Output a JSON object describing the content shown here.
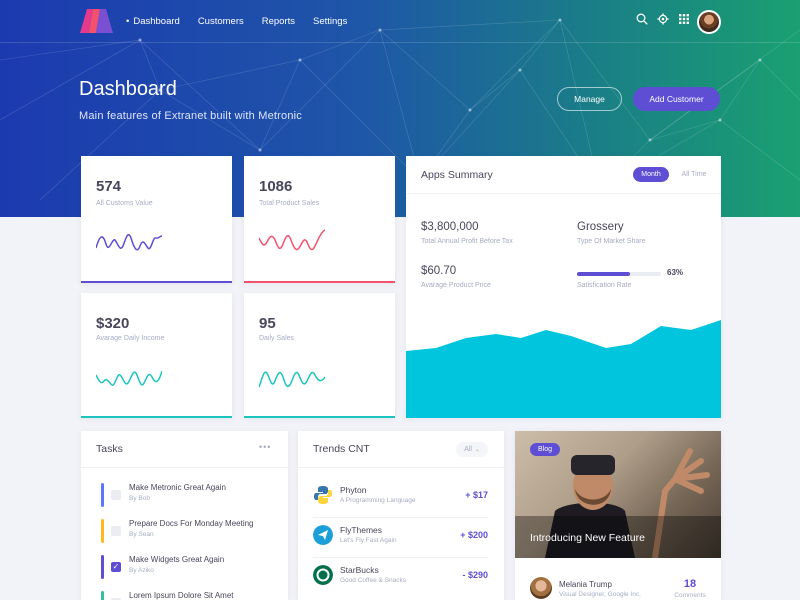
{
  "nav": {
    "items": [
      "Dashboard",
      "Customers",
      "Reports",
      "Settings"
    ],
    "active": 0
  },
  "top_icons": [
    "search-icon",
    "gear-icon",
    "apps-grid-icon"
  ],
  "hero": {
    "title": "Dashboard",
    "subtitle": "Main features of Extranet built with Metronic",
    "manage_label": "Manage",
    "add_label": "Add Customer"
  },
  "stats": [
    {
      "value": "574",
      "label": "All Customs Value",
      "color": "#5d4ed4"
    },
    {
      "value": "1086",
      "label": "Total Product Sales",
      "color": "#f4516c"
    },
    {
      "value": "$320",
      "label": "Avarage Daily Income",
      "color": "#1bc5bd"
    },
    {
      "value": "95",
      "label": "Daily Sales",
      "color": "#1bc5bd"
    }
  ],
  "apps": {
    "title": "Apps Summary",
    "tab_month": "Month",
    "tab_all": "All Time",
    "profit_value": "$3,800,000",
    "profit_label": "Total Annual Profit Before Tax",
    "market_value": "Grossery",
    "market_label": "Type Of Market Share",
    "price_value": "$60.70",
    "price_label": "Avarage Product Price",
    "satisfaction_value": "63%",
    "satisfaction_fraction": 0.63,
    "satisfaction_label": "Satisfication Rate",
    "area_color": "#00c5dc"
  },
  "tasks": {
    "title": "Tasks",
    "menu": "•••",
    "items": [
      {
        "title": "Make Metronic Great Again",
        "by": "By Bob",
        "color": "#5d78ff",
        "done": false
      },
      {
        "title": "Prepare Docs For Monday Meeting",
        "by": "By Sean",
        "color": "#ffb822",
        "done": false
      },
      {
        "title": "Make Widgets Great Again",
        "by": "By Aziko",
        "color": "#5d4ed4",
        "done": true
      },
      {
        "title": "Lorem Ipsum Dolore Sit Amet",
        "by": "",
        "color": "#34bfa3",
        "done": false
      }
    ]
  },
  "trends": {
    "title": "Trends CNT",
    "filter": "All",
    "items": [
      {
        "name": "Phyton",
        "desc": "A Programming Language",
        "amount": "+ $17",
        "icon": "python-icon"
      },
      {
        "name": "FlyThemes",
        "desc": "Let's Fly Fast Again",
        "amount": "+ $200",
        "icon": "paper-plane-icon"
      },
      {
        "name": "StarBucks",
        "desc": "Good Coffee & Snacks",
        "amount": "- $290",
        "icon": "starbucks-icon"
      }
    ]
  },
  "blog": {
    "tag": "Blog",
    "title": "Introducing New Feature",
    "author_name": "Melania Trump",
    "author_role": "Visual Designer, Google Inc.",
    "comments_count": "18",
    "comments_label": "Comments"
  }
}
